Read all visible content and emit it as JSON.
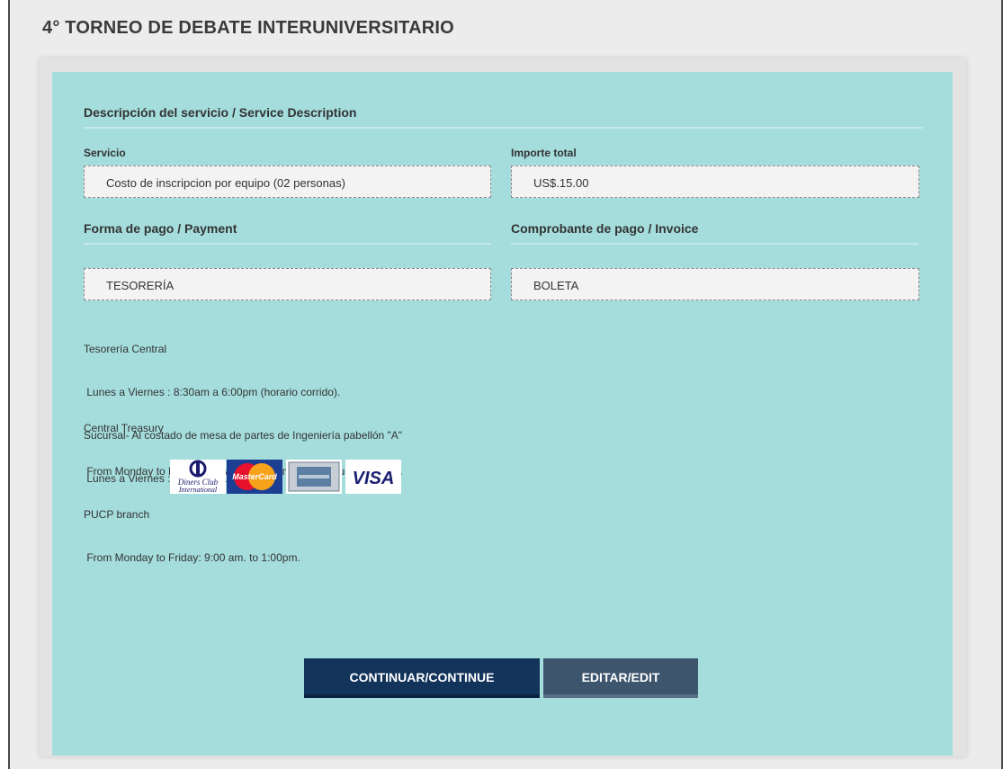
{
  "page": {
    "title": "4° TORNEO DE DEBATE INTERUNIVERSITARIO"
  },
  "service": {
    "section_title": "Descripción del servicio / Service Description",
    "service_label": "Servicio",
    "service_value": "Costo de inscripcion por equipo (02 personas)",
    "amount_label": "Importe total",
    "amount_value": "US$.15.00"
  },
  "payment": {
    "section_title": "Forma de pago / Payment",
    "method_value": "TESORERÍA"
  },
  "invoice": {
    "section_title": "Comprobante de pago / Invoice",
    "type_value": "BOLETA"
  },
  "info": {
    "lines_es": [
      "Tesorería Central",
      " Lunes a Viernes : 8:30am a 6:00pm (horario corrido).",
      "Sucursal- Al costado de mesa de partes de Ingeniería pabellón \"A\"",
      " Lunes a Viernes : 9:00am a 1:00pm"
    ],
    "lines_en": [
      "Central Treasury",
      " From Monday to Friday: 8:30am to 6:00pm (continuous schedule).",
      "PUCP branch",
      " From Monday to Friday: 9:00 am. to 1:00pm."
    ]
  },
  "cards": {
    "diners_line1": "Diners Club",
    "diners_line2": "International",
    "mastercard": "MasterCard",
    "visa": "VISA"
  },
  "buttons": {
    "continue": "CONTINUAR/CONTINUE",
    "edit": "EDITAR/EDIT"
  },
  "colors": {
    "panel": "#a5dddd",
    "primary_button": "#12345a",
    "secondary_button": "#3e556e"
  }
}
